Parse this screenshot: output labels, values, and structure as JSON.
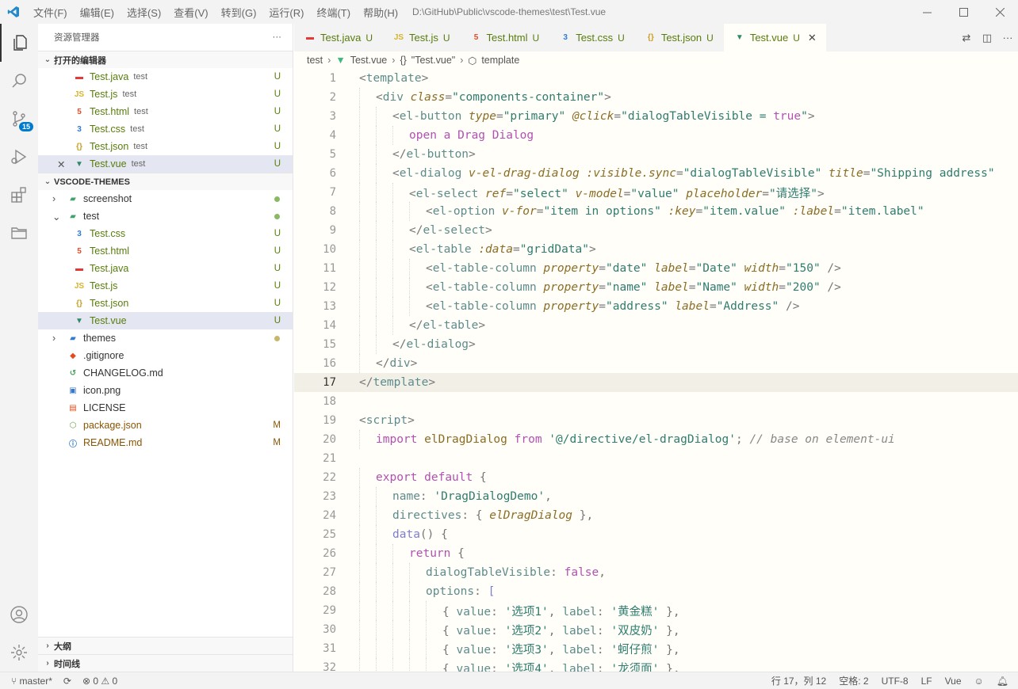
{
  "menu": [
    "文件(F)",
    "编辑(E)",
    "选择(S)",
    "查看(V)",
    "转到(G)",
    "运行(R)",
    "终端(T)",
    "帮助(H)"
  ],
  "window_title": "D:\\GitHub\\Public\\vscode-themes\\test\\Test.vue",
  "activity": {
    "scm_badge": "15"
  },
  "sidebar": {
    "title": "资源管理器",
    "more": "···",
    "open_editors_title": "打开的编辑器",
    "open_editors": [
      {
        "name": "Test.java",
        "desc": "test",
        "status": "U",
        "icon": "java"
      },
      {
        "name": "Test.js",
        "desc": "test",
        "status": "U",
        "icon": "js"
      },
      {
        "name": "Test.html",
        "desc": "test",
        "status": "U",
        "icon": "html"
      },
      {
        "name": "Test.css",
        "desc": "test",
        "status": "U",
        "icon": "css"
      },
      {
        "name": "Test.json",
        "desc": "test",
        "status": "U",
        "icon": "json"
      },
      {
        "name": "Test.vue",
        "desc": "test",
        "status": "U",
        "icon": "vue"
      }
    ],
    "workspace_title": "VSCODE-THEMES",
    "tree": [
      {
        "name": "screenshot"
      },
      {
        "name": "test"
      },
      {
        "name": "Test.css",
        "status": "U"
      },
      {
        "name": "Test.html",
        "status": "U"
      },
      {
        "name": "Test.java",
        "status": "U"
      },
      {
        "name": "Test.js",
        "status": "U"
      },
      {
        "name": "Test.json",
        "status": "U"
      },
      {
        "name": "Test.vue",
        "status": "U"
      },
      {
        "name": "themes"
      },
      {
        "name": ".gitignore"
      },
      {
        "name": "CHANGELOG.md"
      },
      {
        "name": "icon.png"
      },
      {
        "name": "LICENSE"
      },
      {
        "name": "package.json",
        "status": "M"
      },
      {
        "name": "README.md",
        "status": "M"
      }
    ],
    "outline_title": "大纲",
    "timeline_title": "时间线"
  },
  "tabs": [
    {
      "name": "Test.java",
      "status": "U"
    },
    {
      "name": "Test.js",
      "status": "U"
    },
    {
      "name": "Test.html",
      "status": "U"
    },
    {
      "name": "Test.css",
      "status": "U"
    },
    {
      "name": "Test.json",
      "status": "U"
    },
    {
      "name": "Test.vue",
      "status": "U"
    }
  ],
  "breadcrumb": [
    "test",
    "Test.vue",
    "\"Test.vue\"",
    "template"
  ],
  "code_lines": [
    "1",
    "2",
    "3",
    "4",
    "5",
    "6",
    "7",
    "8",
    "9",
    "10",
    "11",
    "12",
    "13",
    "14",
    "15",
    "16",
    "17",
    "18",
    "19",
    "20",
    "21",
    "22",
    "23",
    "24",
    "25",
    "26",
    "27",
    "28",
    "29",
    "30",
    "31",
    "32"
  ],
  "status": {
    "branch": "master*",
    "problems": "0",
    "warnings": "0",
    "position": "行 17，列 12",
    "spaces": "空格: 2",
    "encoding": "UTF-8",
    "eol": "LF",
    "language": "Vue"
  }
}
